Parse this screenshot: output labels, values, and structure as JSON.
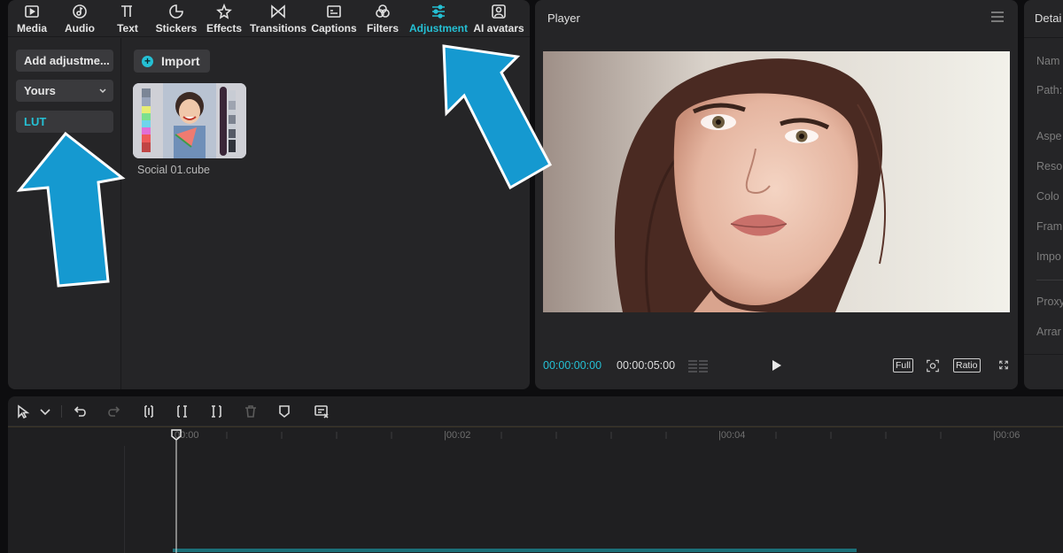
{
  "tabs": [
    {
      "label": "Media",
      "icon": "media-icon"
    },
    {
      "label": "Audio",
      "icon": "audio-icon"
    },
    {
      "label": "Text",
      "icon": "text-icon"
    },
    {
      "label": "Stickers",
      "icon": "stickers-icon"
    },
    {
      "label": "Effects",
      "icon": "effects-icon"
    },
    {
      "label": "Transitions",
      "icon": "transitions-icon"
    },
    {
      "label": "Captions",
      "icon": "captions-icon"
    },
    {
      "label": "Filters",
      "icon": "filters-icon"
    },
    {
      "label": "Adjustment",
      "icon": "adjustment-icon",
      "active": true
    },
    {
      "label": "AI avatars",
      "icon": "ai-avatars-icon"
    }
  ],
  "left_nav": {
    "add_adjustment": "Add adjustme...",
    "yours": "Yours",
    "lut": "LUT"
  },
  "content": {
    "import_label": "Import",
    "lut_file": "Social 01.cube"
  },
  "player": {
    "title": "Player",
    "timecode_current": "00:00:00:00",
    "timecode_total": "00:00:05:00",
    "full_label": "Full",
    "ratio_label": "Ratio"
  },
  "details": {
    "title": "Detai",
    "labels": [
      "Nam",
      "Path:",
      "Aspe",
      "Reso",
      "Colo",
      "Fram",
      "Impo",
      "Proxy",
      "Arrar"
    ]
  },
  "timeline": {
    "ticks": [
      "00:00",
      "|00:02",
      "|00:04",
      "|00:06"
    ]
  },
  "colors": {
    "accent": "#25c0d4",
    "arrow": "#1599d0"
  }
}
